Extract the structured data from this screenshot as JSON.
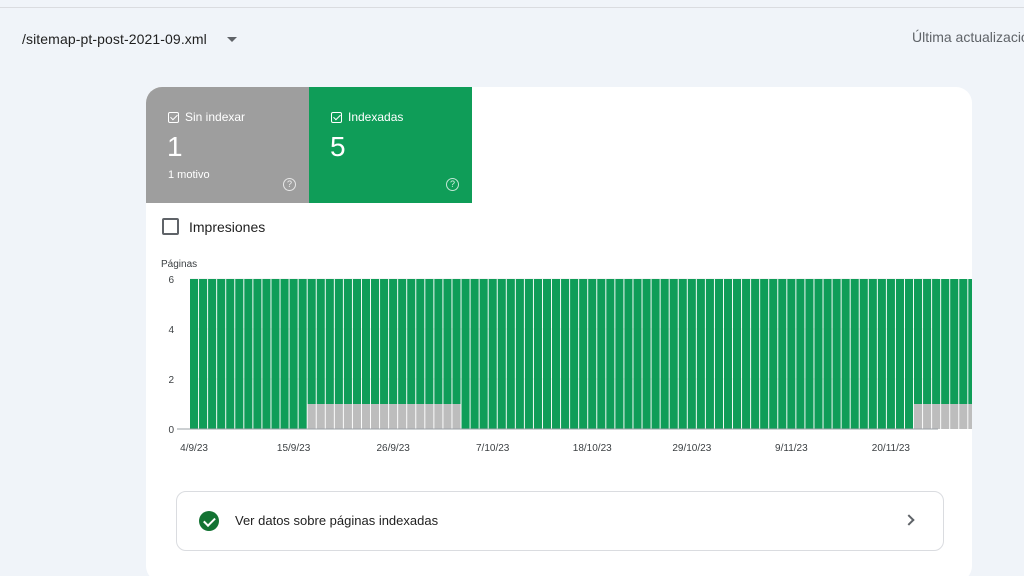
{
  "header": {
    "sitemap_label": "/sitemap-pt-post-2021-09.xml",
    "last_update_label": "Última actualizació"
  },
  "metrics": [
    {
      "label": "Sin indexar",
      "value": "1",
      "sub": "1 motivo",
      "color": "#9e9e9e",
      "checked": true
    },
    {
      "label": "Indexadas",
      "value": "5",
      "sub": "",
      "color": "#0f9d58",
      "checked": true
    }
  ],
  "impressions": {
    "label": "Impresiones",
    "checked": false
  },
  "link": {
    "label": "Ver datos sobre páginas indexadas"
  },
  "icons": {
    "help": "help-icon",
    "check": "check-circle-icon",
    "chevron": "chevron-right-icon",
    "dropdown": "caret-down-icon"
  },
  "chart_data": {
    "type": "bar",
    "stacked": true,
    "ylabel": "Páginas",
    "ylim": [
      0,
      6
    ],
    "yticks": [
      0,
      2,
      4,
      6
    ],
    "xtick_labels": [
      "4/9/23",
      "15/9/23",
      "26/9/23",
      "7/10/23",
      "18/10/23",
      "29/10/23",
      "9/11/23",
      "20/11/23"
    ],
    "xtick_indices": [
      0,
      11,
      22,
      33,
      44,
      55,
      66,
      77
    ],
    "grid": true,
    "series": [
      {
        "name": "Sin indexar",
        "color": "#bdbdbd",
        "values": [
          0,
          0,
          0,
          0,
          0,
          0,
          0,
          0,
          0,
          0,
          0,
          0,
          0,
          1,
          1,
          1,
          1,
          1,
          1,
          1,
          1,
          1,
          1,
          1,
          1,
          1,
          1,
          1,
          1,
          1,
          0,
          0,
          0,
          0,
          0,
          0,
          0,
          0,
          0,
          0,
          0,
          0,
          0,
          0,
          0,
          0,
          0,
          0,
          0,
          0,
          0,
          0,
          0,
          0,
          0,
          0,
          0,
          0,
          0,
          0,
          0,
          0,
          0,
          0,
          0,
          0,
          0,
          0,
          0,
          0,
          0,
          0,
          0,
          0,
          0,
          0,
          0,
          0,
          0,
          0,
          1,
          1,
          1,
          1,
          1,
          1,
          1
        ]
      },
      {
        "name": "Indexadas",
        "color": "#0f9d58",
        "values": [
          6,
          6,
          6,
          6,
          6,
          6,
          6,
          6,
          6,
          6,
          6,
          6,
          6,
          5,
          5,
          5,
          5,
          5,
          5,
          5,
          5,
          5,
          5,
          5,
          5,
          5,
          5,
          5,
          5,
          5,
          6,
          6,
          6,
          6,
          6,
          6,
          6,
          6,
          6,
          6,
          6,
          6,
          6,
          6,
          6,
          6,
          6,
          6,
          6,
          6,
          6,
          6,
          6,
          6,
          6,
          6,
          6,
          6,
          6,
          6,
          6,
          6,
          6,
          6,
          6,
          6,
          6,
          6,
          6,
          6,
          6,
          6,
          6,
          6,
          6,
          6,
          6,
          6,
          6,
          6,
          5,
          5,
          5,
          5,
          5,
          5,
          5
        ]
      }
    ]
  }
}
